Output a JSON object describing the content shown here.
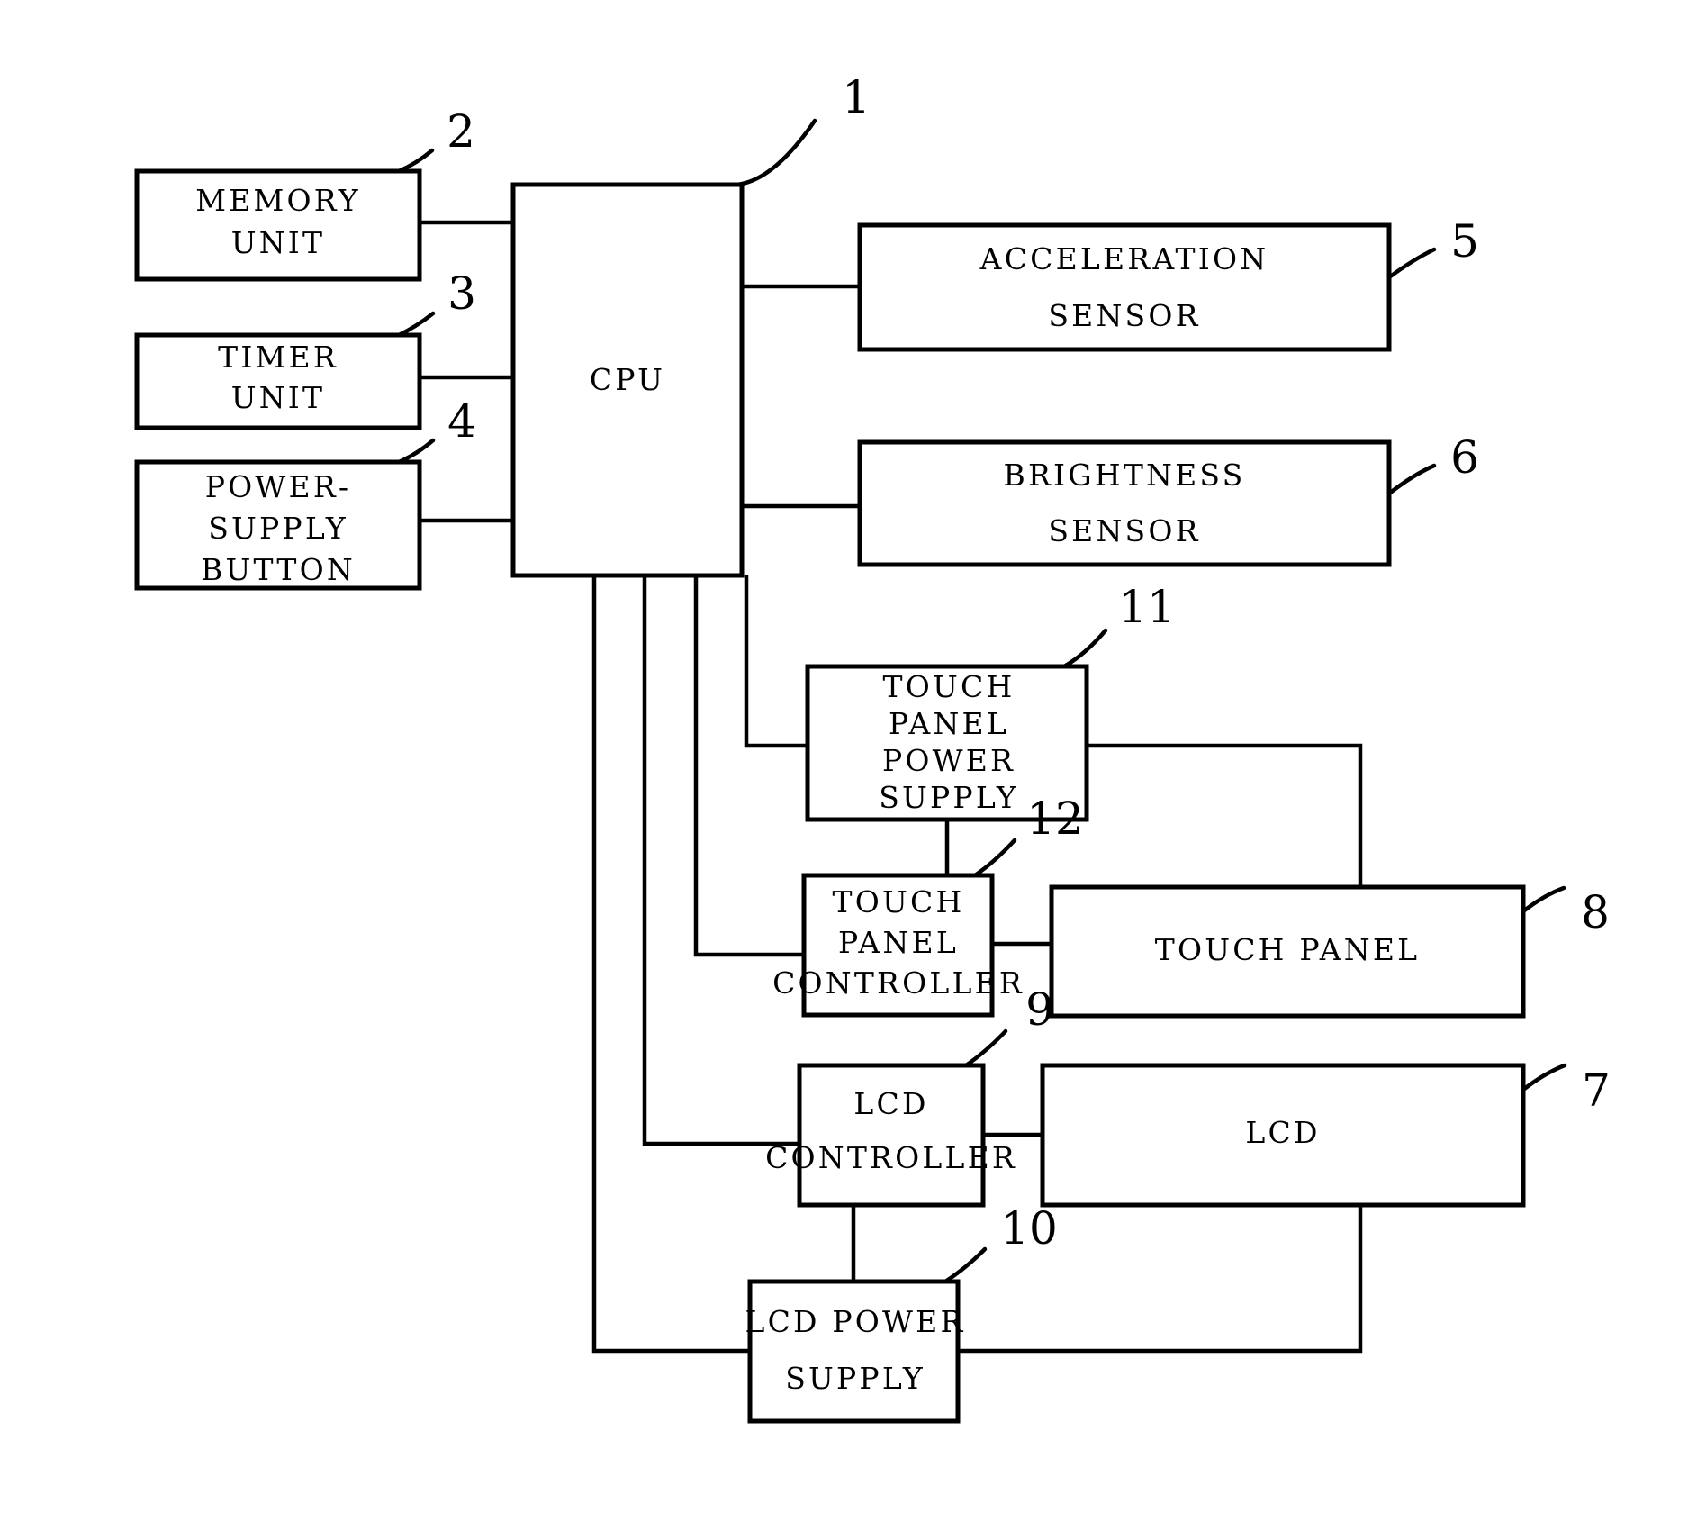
{
  "figure": {
    "type": "patent-block-diagram",
    "background_color": "#ffffff",
    "line_color": "#000000"
  },
  "blocks": {
    "cpu": {
      "label": "CPU",
      "ref": "1",
      "lines": [
        "CPU"
      ]
    },
    "memory_unit": {
      "label": "MEMORY UNIT",
      "ref": "2",
      "lines": [
        "MEMORY",
        "UNIT"
      ]
    },
    "timer_unit": {
      "label": "TIMER UNIT",
      "ref": "3",
      "lines": [
        "TIMER",
        "UNIT"
      ]
    },
    "power_supply_button": {
      "label": "POWER-SUPPLY BUTTON",
      "ref": "4",
      "lines": [
        "POWER-",
        "SUPPLY",
        "BUTTON"
      ]
    },
    "acceleration_sensor": {
      "label": "ACCELERATION SENSOR",
      "ref": "5",
      "lines": [
        "ACCELERATION",
        "SENSOR"
      ]
    },
    "brightness_sensor": {
      "label": "BRIGHTNESS SENSOR",
      "ref": "6",
      "lines": [
        "BRIGHTNESS",
        "SENSOR"
      ]
    },
    "lcd": {
      "label": "LCD",
      "ref": "7",
      "lines": [
        "LCD"
      ]
    },
    "touch_panel": {
      "label": "TOUCH PANEL",
      "ref": "8",
      "lines": [
        "TOUCH  PANEL"
      ]
    },
    "lcd_controller": {
      "label": "LCD CONTROLLER",
      "ref": "9",
      "lines": [
        "LCD",
        "CONTROLLER"
      ]
    },
    "lcd_power_supply": {
      "label": "LCD POWER SUPPLY",
      "ref": "10",
      "lines": [
        "LCD  POWER",
        "SUPPLY"
      ]
    },
    "touch_panel_power_supply": {
      "label": "TOUCH PANEL POWER SUPPLY",
      "ref": "11",
      "lines": [
        "TOUCH",
        "PANEL",
        "POWER",
        "SUPPLY"
      ]
    },
    "touch_panel_controller": {
      "label": "TOUCH PANEL CONTROLLER",
      "ref": "12",
      "lines": [
        "TOUCH",
        "PANEL",
        "CONTROLLER"
      ]
    }
  },
  "reference_numerals": [
    "1",
    "2",
    "3",
    "4",
    "5",
    "6",
    "7",
    "8",
    "9",
    "10",
    "11",
    "12"
  ]
}
